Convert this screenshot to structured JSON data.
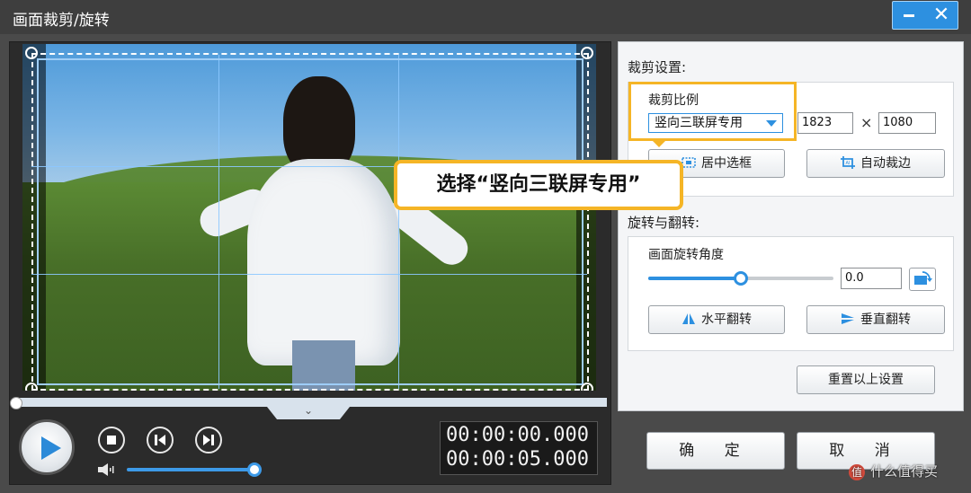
{
  "window": {
    "title": "画面裁剪/旋转",
    "minimize_icon": "minimize-icon",
    "close_icon": "close-icon",
    "close_glyph": "✕"
  },
  "preview": {
    "timecode_current": "00:00:00.000",
    "timecode_total": "00:00:05.000",
    "playback_progress": 0,
    "volume_level": 0.95,
    "icons": [
      "play-icon",
      "stop-icon",
      "previous-frame-icon",
      "next-frame-icon",
      "volume-icon",
      "chevron-down-icon"
    ]
  },
  "crop": {
    "section_title": "裁剪设置:",
    "ratio_label": "裁剪比例",
    "ratio_selected": "竖向三联屏专用",
    "width": "1823",
    "times": "×",
    "height": "1080",
    "center_button": "居中选框",
    "auto_crop_button": "自动裁边"
  },
  "rotate": {
    "section_title": "旋转与翻转:",
    "angle_label": "画面旋转角度",
    "angle_value": "0.0",
    "angle_slider_fraction": 0.5,
    "hflip_button": "水平翻转",
    "vflip_button": "垂直翻转"
  },
  "reset_button": "重置以上设置",
  "callout": "选择“竖向三联屏专用”",
  "ok_button": "确 定",
  "cancel_button": "取 消",
  "watermark": "什么值得买",
  "watermark_icon": "值",
  "colors": {
    "accent": "#2d90e0",
    "highlight": "#f5b526"
  }
}
